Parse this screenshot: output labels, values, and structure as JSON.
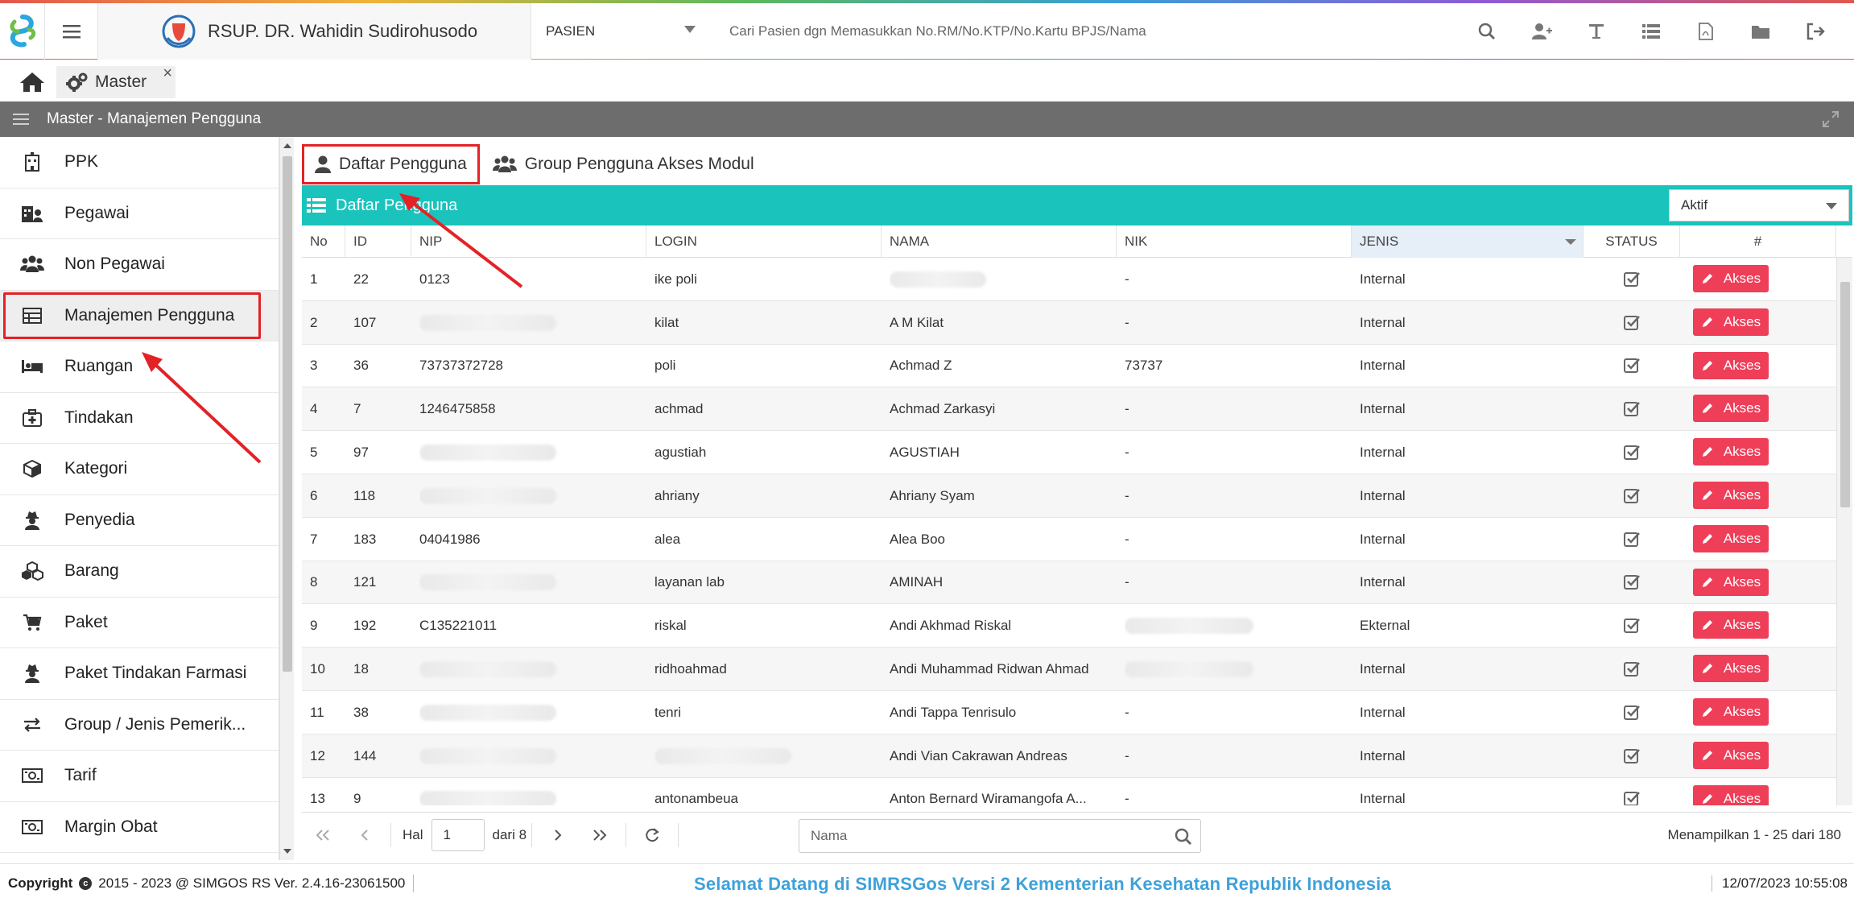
{
  "header": {
    "hospital_name": "RSUP. DR. Wahidin Sudirohusodo",
    "pasien_select": "PASIEN",
    "search_placeholder": "Cari Pasien dgn Memasukkan No.RM/No.KTP/No.Kartu BPJS/Nama",
    "icons": [
      "search-icon",
      "user-plus-icon",
      "text-icon",
      "list-icon",
      "pdf-icon",
      "folder-icon",
      "sign-out-icon"
    ]
  },
  "tabs": {
    "home_icon": "home-icon",
    "master_label": "Master",
    "close": "×"
  },
  "section": {
    "title": "Master - Manajemen Pengguna"
  },
  "sidebar": {
    "items": [
      {
        "label": "PPK",
        "icon": "hospital-icon"
      },
      {
        "label": "Pegawai",
        "icon": "building-user-icon"
      },
      {
        "label": "Non Pegawai",
        "icon": "users-icon"
      },
      {
        "label": "Manajemen Pengguna",
        "icon": "table-icon",
        "active": true
      },
      {
        "label": "Ruangan",
        "icon": "bed-icon"
      },
      {
        "label": "Tindakan",
        "icon": "medkit-icon"
      },
      {
        "label": "Kategori",
        "icon": "cube-icon"
      },
      {
        "label": "Penyedia",
        "icon": "user-secret-icon"
      },
      {
        "label": "Barang",
        "icon": "cubes-icon"
      },
      {
        "label": "Paket",
        "icon": "cart-icon"
      },
      {
        "label": "Paket Tindakan Farmasi",
        "icon": "user-secret-icon"
      },
      {
        "label": "Group / Jenis Pemerik...",
        "icon": "exchange-icon"
      },
      {
        "label": "Tarif",
        "icon": "money-icon"
      },
      {
        "label": "Margin Obat",
        "icon": "money-icon"
      }
    ]
  },
  "subtabs": [
    {
      "label": "Daftar Pengguna",
      "icon": "user-icon",
      "active": true
    },
    {
      "label": "Group Pengguna Akses Modul",
      "icon": "users-icon"
    }
  ],
  "panel": {
    "title": "Daftar Pengguna",
    "filter_value": "Aktif"
  },
  "grid": {
    "columns": [
      "No",
      "ID",
      "NIP",
      "LOGIN",
      "NAMA",
      "NIK",
      "JENIS",
      "STATUS",
      "#"
    ],
    "action_label": "Akses",
    "rows": [
      {
        "no": "1",
        "id": "22",
        "nip": "0123",
        "login": "ike poli",
        "nama": "",
        "nik": "-",
        "jenis": "Internal",
        "blur": [
          "nama"
        ]
      },
      {
        "no": "2",
        "id": "107",
        "nip": "",
        "login": "kilat",
        "nama": "A M Kilat",
        "nik": "-",
        "jenis": "Internal",
        "blur": [
          "nip"
        ]
      },
      {
        "no": "3",
        "id": "36",
        "nip": "73737372728",
        "login": "poli",
        "nama": "Achmad Z",
        "nik": "73737",
        "jenis": "Internal",
        "blur": []
      },
      {
        "no": "4",
        "id": "7",
        "nip": "1246475858",
        "login": "achmad",
        "nama": "Achmad Zarkasyi",
        "nik": "-",
        "jenis": "Internal",
        "blur": []
      },
      {
        "no": "5",
        "id": "97",
        "nip": "",
        "login": "agustiah",
        "nama": "AGUSTIAH",
        "nik": "-",
        "jenis": "Internal",
        "blur": [
          "nip"
        ]
      },
      {
        "no": "6",
        "id": "118",
        "nip": "",
        "login": "ahriany",
        "nama": "Ahriany Syam",
        "nik": "-",
        "jenis": "Internal",
        "blur": [
          "nip"
        ]
      },
      {
        "no": "7",
        "id": "183",
        "nip": "04041986",
        "login": "alea",
        "nama": "Alea Boo",
        "nik": "-",
        "jenis": "Internal",
        "blur": []
      },
      {
        "no": "8",
        "id": "121",
        "nip": "",
        "login": "layanan lab",
        "nama": "AMINAH",
        "nik": "-",
        "jenis": "Internal",
        "blur": [
          "nip"
        ]
      },
      {
        "no": "9",
        "id": "192",
        "nip": "C135221011",
        "login": "riskal",
        "nama": "Andi Akhmad Riskal",
        "nik": "",
        "jenis": "Ekternal",
        "blur": [
          "nik"
        ]
      },
      {
        "no": "10",
        "id": "18",
        "nip": "",
        "login": "ridhoahmad",
        "nama": "Andi Muhammad Ridwan Ahmad",
        "nik": "",
        "jenis": "Internal",
        "blur": [
          "nip",
          "nik"
        ]
      },
      {
        "no": "11",
        "id": "38",
        "nip": "",
        "login": "tenri",
        "nama": "Andi Tappa Tenrisulo",
        "nik": "-",
        "jenis": "Internal",
        "blur": [
          "nip"
        ]
      },
      {
        "no": "12",
        "id": "144",
        "nip": "",
        "login": "",
        "nama": "Andi Vian Cakrawan Andreas",
        "nik": "-",
        "jenis": "Internal",
        "blur": [
          "nip",
          "login"
        ]
      },
      {
        "no": "13",
        "id": "9",
        "nip": "",
        "login": "antonambeua",
        "nama": "Anton Bernard Wiramangofa A...",
        "nik": "-",
        "jenis": "Internal",
        "blur": [
          "nip"
        ]
      }
    ]
  },
  "pager": {
    "hal_label": "Hal",
    "page": "1",
    "total_label": "dari 8",
    "nama_placeholder": "Nama",
    "count_text": "Menampilkan 1 - 25 dari 180"
  },
  "footer": {
    "copyright_label": "Copyright",
    "copyright_text": "2015 - 2023 @ SIMGOS RS Ver. 2.4.16-23061500",
    "welcome": "Selamat Datang di SIMRSGos Versi 2 Kementerian Kesehatan Republik Indonesia",
    "datetime": "12/07/2023 10:55:08"
  },
  "colors": {
    "teal": "#1bc3bd",
    "header_gray": "#6d6d6d",
    "akses_red": "#ee3e58",
    "annotation_red": "#e32227",
    "welcome_blue": "#3ea1d9"
  }
}
